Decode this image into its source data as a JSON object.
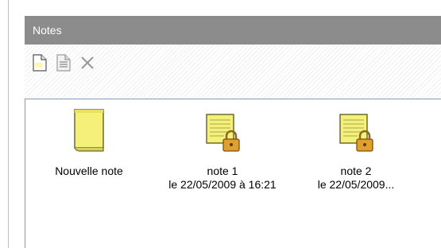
{
  "panel": {
    "title": "Notes"
  },
  "toolbar": {
    "buttons": [
      {
        "icon": "new-note-icon"
      },
      {
        "icon": "properties-icon"
      },
      {
        "icon": "delete-icon"
      }
    ]
  },
  "items": [
    {
      "name": "Nouvelle note",
      "date": "",
      "icon": "new-note-icon"
    },
    {
      "name": "note 1",
      "date": "le 22/05/2009 à 16:21",
      "icon": "locked-note-icon"
    },
    {
      "name": "note 2",
      "date": "le 22/05/2009...",
      "icon": "locked-note-icon"
    }
  ],
  "colors": {
    "title_bar": "#8c8c8c",
    "note_yellow": "#f5f07a"
  }
}
